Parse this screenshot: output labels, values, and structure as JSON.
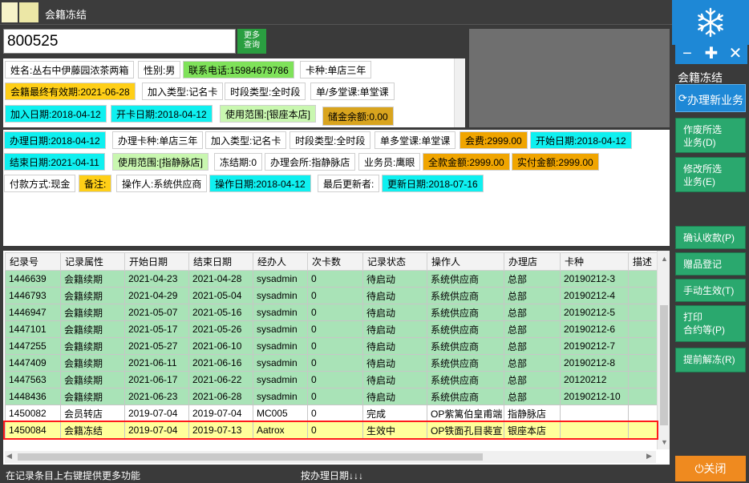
{
  "window": {
    "title": "会籍冻结"
  },
  "search": {
    "value": "800525",
    "more_label": "更多\n查询"
  },
  "member_info": {
    "name": "姓名:丛右中伊藤园浓茶两箱",
    "gender": "性别:男",
    "phone": "联系电话:15984679786",
    "card_type": "卡种:单店三年",
    "expiry": "会籍最终有效期:2021-06-28",
    "join_type": "加入类型:记名卡",
    "period_type": "时段类型:全时段",
    "class_type": "单/多堂课:单堂课",
    "join_date": "加入日期:2018-04-12",
    "open_date": "开卡日期:2018-04-12",
    "scope": "使用范围:[银座本店]",
    "balance": "储金余额:0.00"
  },
  "detail": {
    "process_date": "办理日期:2018-04-12",
    "process_card": "办理卡种:单店三年",
    "join_type": "加入类型:记名卡",
    "period_type": "时段类型:全时段",
    "class_type": "单多堂课:单堂课",
    "fee": "会费:2999.00",
    "start_date": "开始日期:2018-04-12",
    "end_date": "结束日期:2021-04-11",
    "scope": "使用范围:[指静脉店]",
    "freeze_count": "冻结期:0",
    "process_store": "办理会所:指静脉店",
    "salesperson": "业务员:鹰眼",
    "total_amount": "全款金额:2999.00",
    "paid_amount": "实付金额:2999.00",
    "payment": "付款方式:现金",
    "note": "备注:",
    "operator": "操作人:系统供应商",
    "operate_date": "操作日期:2018-04-12",
    "last_updater": "最后更新者:",
    "update_date": "更新日期:2018-07-16"
  },
  "table": {
    "columns": [
      "纪录号",
      "记录属性",
      "开始日期",
      "结束日期",
      "经办人",
      "次卡数",
      "记录状态",
      "操作人",
      "办理店",
      "卡种",
      "描述"
    ],
    "rows": [
      {
        "style": "green",
        "cells": [
          "1446639",
          "会籍续期",
          "2021-04-23",
          "2021-04-28",
          "sysadmin",
          "0",
          "待启动",
          "系统供应商",
          "总部",
          "20190212-3",
          ""
        ]
      },
      {
        "style": "green",
        "cells": [
          "1446793",
          "会籍续期",
          "2021-04-29",
          "2021-05-04",
          "sysadmin",
          "0",
          "待启动",
          "系统供应商",
          "总部",
          "20190212-4",
          ""
        ]
      },
      {
        "style": "green",
        "cells": [
          "1446947",
          "会籍续期",
          "2021-05-07",
          "2021-05-16",
          "sysadmin",
          "0",
          "待启动",
          "系统供应商",
          "总部",
          "20190212-5",
          ""
        ]
      },
      {
        "style": "green",
        "cells": [
          "1447101",
          "会籍续期",
          "2021-05-17",
          "2021-05-26",
          "sysadmin",
          "0",
          "待启动",
          "系统供应商",
          "总部",
          "20190212-6",
          ""
        ]
      },
      {
        "style": "green",
        "cells": [
          "1447255",
          "会籍续期",
          "2021-05-27",
          "2021-06-10",
          "sysadmin",
          "0",
          "待启动",
          "系统供应商",
          "总部",
          "20190212-7",
          ""
        ]
      },
      {
        "style": "green",
        "cells": [
          "1447409",
          "会籍续期",
          "2021-06-11",
          "2021-06-16",
          "sysadmin",
          "0",
          "待启动",
          "系统供应商",
          "总部",
          "20190212-8",
          ""
        ]
      },
      {
        "style": "green",
        "cells": [
          "1447563",
          "会籍续期",
          "2021-06-17",
          "2021-06-22",
          "sysadmin",
          "0",
          "待启动",
          "系统供应商",
          "总部",
          "20120212",
          ""
        ]
      },
      {
        "style": "green",
        "cells": [
          "1448436",
          "会籍续期",
          "2021-06-23",
          "2021-06-28",
          "sysadmin",
          "0",
          "待启动",
          "系统供应商",
          "总部",
          "20190212-10",
          ""
        ]
      },
      {
        "style": "white",
        "cells": [
          "1450082",
          "会员转店",
          "2019-07-04",
          "2019-07-04",
          "MC005",
          "0",
          "完成",
          "OP紫篱伯皇甫端",
          "指静脉店",
          "",
          ""
        ]
      },
      {
        "style": "sel",
        "cells": [
          "1450084",
          "会籍冻结",
          "2019-07-04",
          "2019-07-13",
          "Aatrox",
          "0",
          "生效中",
          "OP铁面孔目裴宣",
          "银座本店",
          "",
          ""
        ]
      }
    ]
  },
  "sidebar": {
    "label": "会籍冻结",
    "new_business": "办理新业务",
    "buttons": [
      "作废所选\n业务(D)",
      "修改所选\n业务(E)",
      "确认收款(P)",
      "赠品登记",
      "手动生效(T)",
      "打印\n合约等(P)",
      "提前解冻(R)"
    ],
    "close": "关闭"
  },
  "status": {
    "left": "在记录条目上右键提供更多功能",
    "center": "按办理日期↓↓↓"
  },
  "colors": {
    "accent": "#1e88d6",
    "green_button": "#2aa86e",
    "close_button": "#ef8a1f",
    "selection": "#ff1a1a"
  }
}
